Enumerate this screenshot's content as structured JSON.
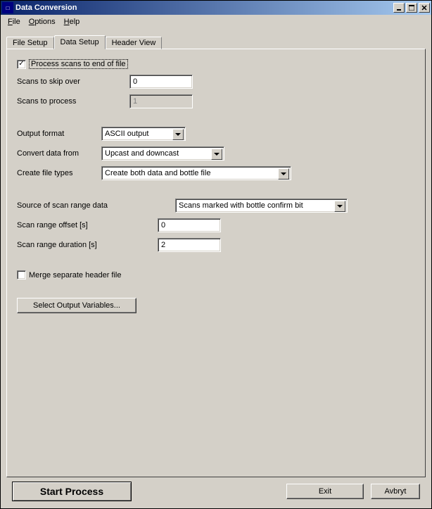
{
  "window": {
    "title": "Data Conversion"
  },
  "menu": {
    "file": "File",
    "options": "Options",
    "help": "Help"
  },
  "tabs": {
    "file_setup": "File Setup",
    "data_setup": "Data Setup",
    "header_view": "Header View",
    "active": "data_setup"
  },
  "form": {
    "process_scans": {
      "label": "Process scans to end of file",
      "checked": true
    },
    "scans_to_skip": {
      "label": "Scans to skip over",
      "value": "0"
    },
    "scans_to_process": {
      "label": "Scans to process",
      "value": "1",
      "disabled": true
    },
    "output_format": {
      "label": "Output format",
      "value": "ASCII output"
    },
    "convert_from": {
      "label": "Convert data from",
      "value": "Upcast and downcast"
    },
    "create_file_types": {
      "label": "Create file types",
      "value": "Create both data and bottle file"
    },
    "source_scan_range": {
      "label": "Source of scan range data",
      "value": "Scans marked with bottle confirm bit"
    },
    "scan_range_offset": {
      "label": "Scan range offset [s]",
      "value": "0"
    },
    "scan_range_duration": {
      "label": "Scan range duration [s]",
      "value": "2"
    },
    "merge_header": {
      "label": "Merge separate header file",
      "checked": false
    },
    "select_output_vars": "Select Output Variables..."
  },
  "buttons": {
    "start": "Start Process",
    "exit": "Exit",
    "cancel": "Avbryt"
  }
}
